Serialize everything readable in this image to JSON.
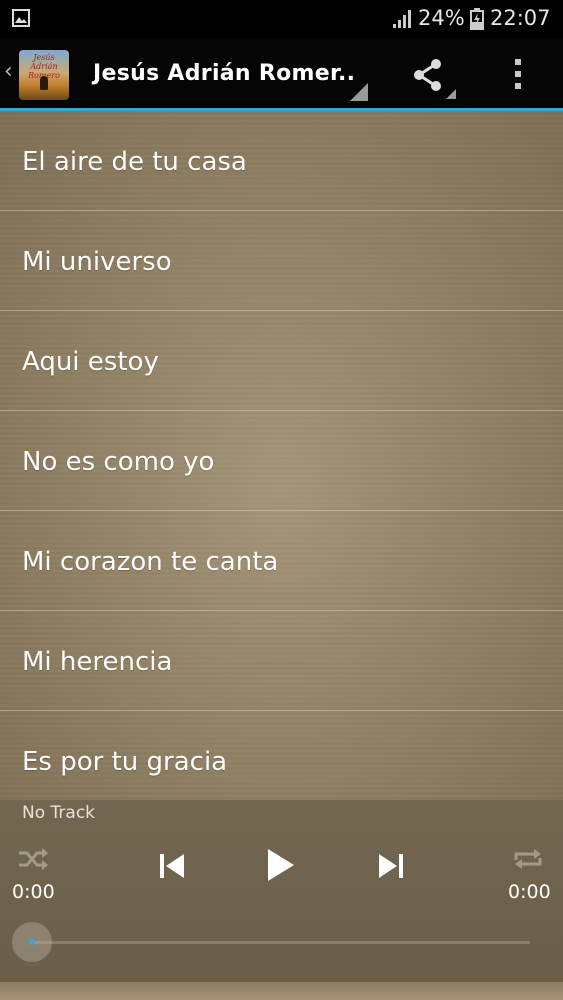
{
  "status_bar": {
    "battery_percent": "24%",
    "time": "22:07",
    "icons": [
      "gallery-icon",
      "signal-icon",
      "battery-charging-icon"
    ]
  },
  "action_bar": {
    "title": "Jesús Adrián Romer..",
    "logo_text": "Jesús Adrián Romero",
    "icons": [
      "back-chevron-icon",
      "share-icon",
      "overflow-menu-icon"
    ],
    "accent_color": "#35a9c9"
  },
  "tracks": [
    "El aire de tu casa",
    "Mi universo",
    "Aqui estoy",
    "No es como yo",
    "Mi corazon te canta",
    "Mi herencia",
    "Es por tu gracia"
  ],
  "player": {
    "now_playing": "No Track",
    "elapsed": "0:00",
    "total": "0:00",
    "progress": 0,
    "icons": [
      "shuffle-icon",
      "previous-icon",
      "play-icon",
      "next-icon",
      "repeat-icon"
    ]
  }
}
